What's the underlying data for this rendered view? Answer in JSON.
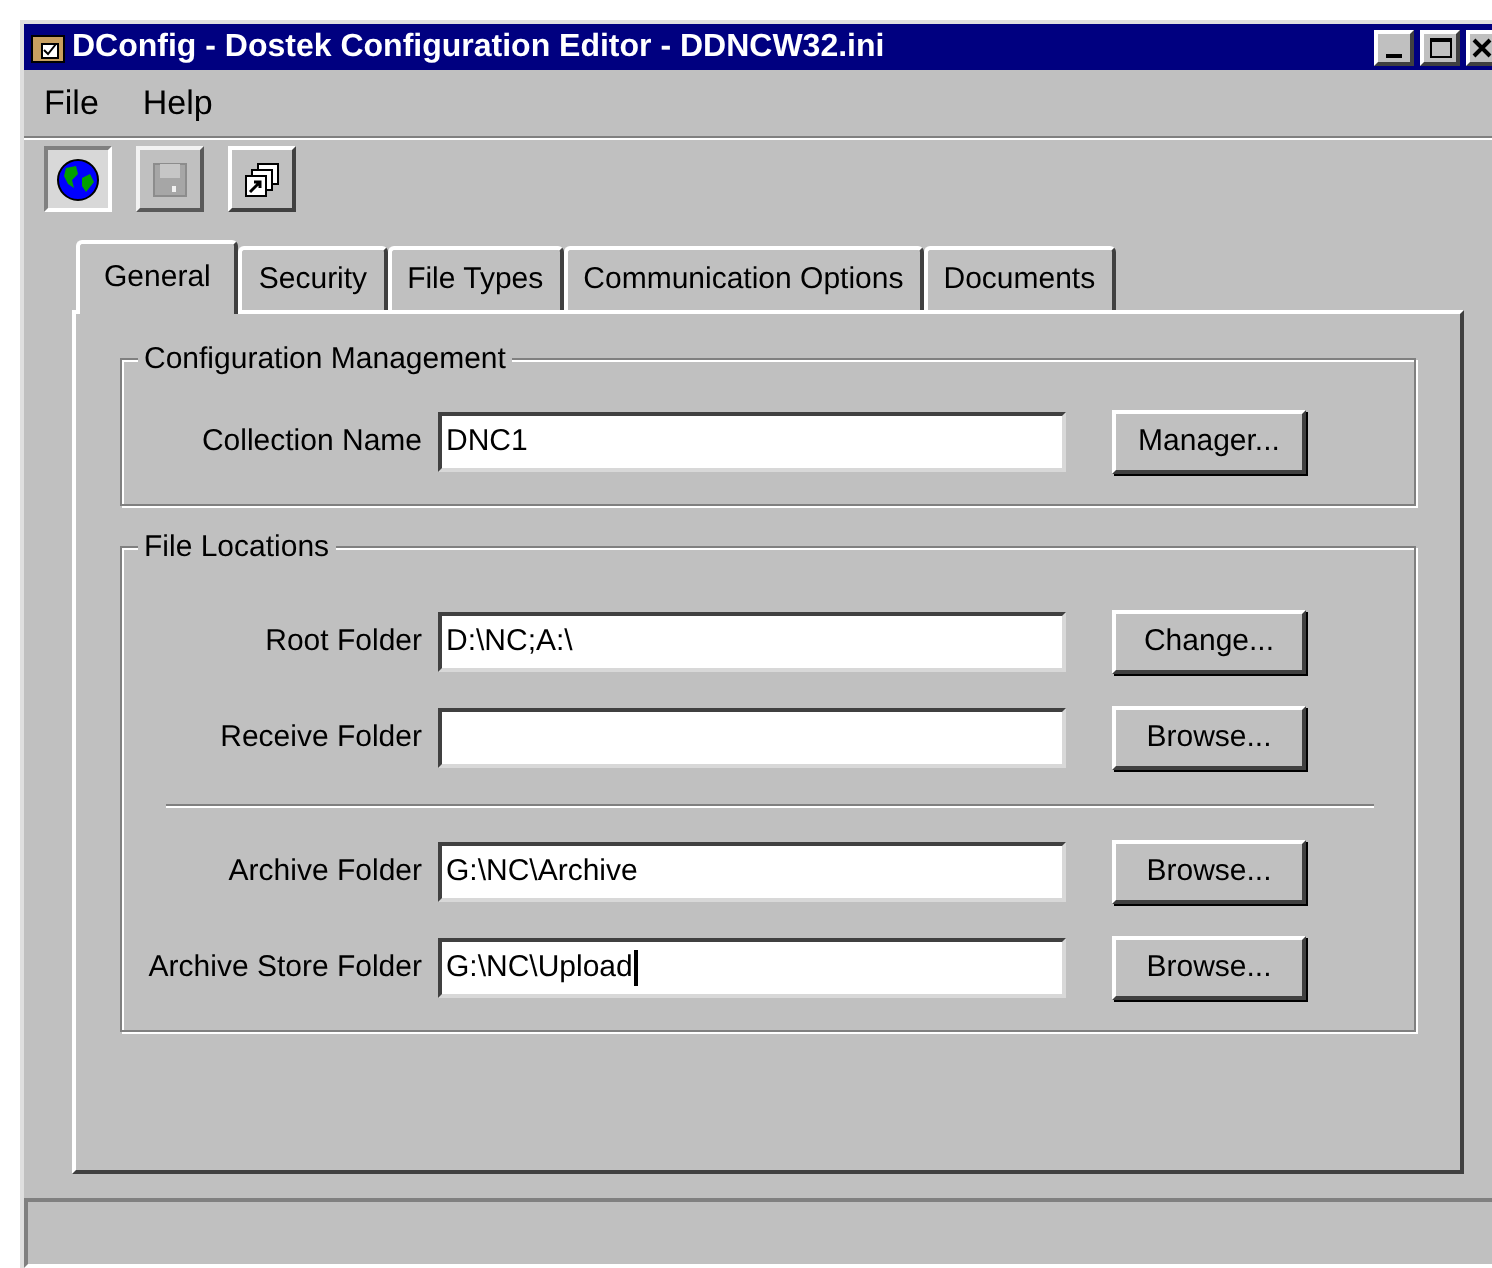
{
  "window": {
    "title": "DConfig - Dostek Configuration Editor - DDNCW32.ini"
  },
  "menu": [
    {
      "label": "File"
    },
    {
      "label": "Help"
    }
  ],
  "toolbar": [
    {
      "kind": "globe",
      "pressed": true,
      "disabled": false
    },
    {
      "kind": "save",
      "pressed": false,
      "disabled": true
    },
    {
      "kind": "windows",
      "pressed": false,
      "disabled": false
    }
  ],
  "tabs": [
    {
      "label": "General",
      "selected": true
    },
    {
      "label": "Security",
      "selected": false
    },
    {
      "label": "File Types",
      "selected": false
    },
    {
      "label": "Communication Options",
      "selected": false
    },
    {
      "label": "Documents",
      "selected": false
    }
  ],
  "groups": [
    {
      "title": "Configuration Management",
      "sections": [
        [
          {
            "label": "Collection Name",
            "value": "DNC1",
            "focused": false,
            "button": "Manager..."
          }
        ]
      ]
    },
    {
      "title": "File Locations",
      "sections": [
        [
          {
            "label": "Root Folder",
            "value": "D:\\NC;A:\\",
            "focused": false,
            "button": "Change..."
          },
          {
            "label": "Receive Folder",
            "focused": false,
            "button": "Browse..."
          }
        ],
        [
          {
            "label": "Archive Folder",
            "value": "G:\\NC\\Archive",
            "focused": false,
            "button": "Browse..."
          },
          {
            "label": "Archive Store Folder",
            "value": "G:\\NC\\Upload",
            "focused": true,
            "button": "Browse..."
          }
        ]
      ]
    }
  ]
}
